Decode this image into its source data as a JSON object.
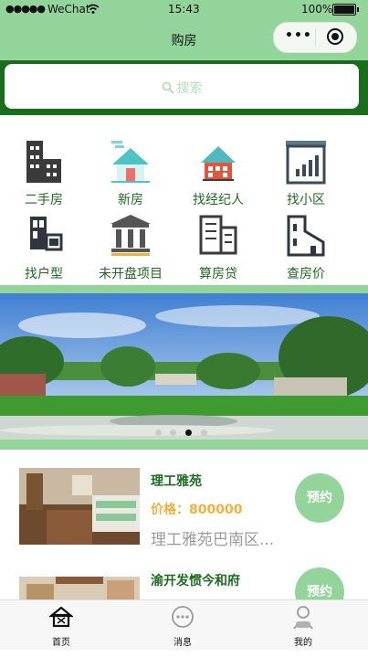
{
  "status_bar": {
    "signal": "●●●●●",
    "carrier": "WeChat",
    "time": "15:43",
    "battery": "100%"
  },
  "nav": {
    "title": "购房",
    "more": "•••"
  },
  "search": {
    "placeholder": "搜索"
  },
  "grid": [
    {
      "label": "二手房",
      "icon": "building-icon"
    },
    {
      "label": "新房",
      "icon": "house-icon"
    },
    {
      "label": "找经纪人",
      "icon": "agent-house-icon"
    },
    {
      "label": "找小区",
      "icon": "community-board-icon"
    },
    {
      "label": "找户型",
      "icon": "layout-icon"
    },
    {
      "label": "未开盘项目",
      "icon": "bank-icon"
    },
    {
      "label": "算房贷",
      "icon": "calculator-building-icon"
    },
    {
      "label": "查房价",
      "icon": "price-house-icon"
    }
  ],
  "banner": {
    "slides": 4,
    "active_slide": 3
  },
  "listings": [
    {
      "name": "理工雅苑",
      "price": "价格：800000",
      "address": "理工雅苑巴南区...",
      "action": "预约"
    },
    {
      "name": "渝开发惯今和府",
      "price": "",
      "address": "",
      "action": "预约"
    }
  ],
  "tabs": [
    {
      "label": "首页",
      "icon": "home-icon"
    },
    {
      "label": "消息",
      "icon": "message-icon"
    },
    {
      "label": "我的",
      "icon": "profile-icon"
    }
  ],
  "colors": {
    "nav_green": "#93d49b",
    "band_green": "#1a6d1c",
    "label_green": "#1e6b22",
    "price_orange": "#f4b03c",
    "button_green": "#93d49b"
  }
}
